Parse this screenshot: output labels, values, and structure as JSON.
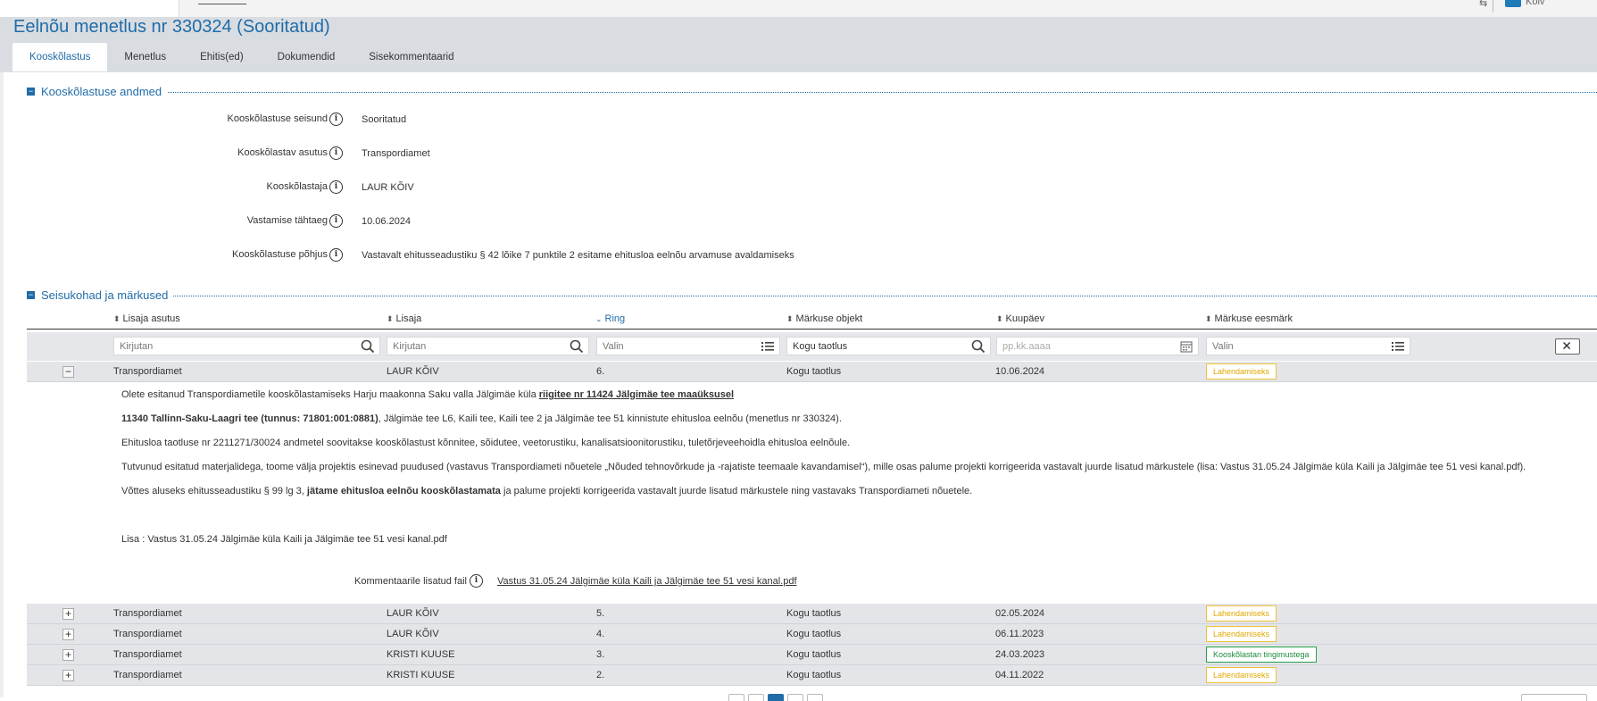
{
  "top_bar": {
    "user_name": "Kõiv"
  },
  "page": {
    "title": "Eelnõu menetlus nr 330324 (Sooritatud)"
  },
  "tabs": [
    {
      "label": "Kooskõlastus"
    },
    {
      "label": "Menetlus"
    },
    {
      "label": "Ehitis(ed)"
    },
    {
      "label": "Dokumendid"
    },
    {
      "label": "Sisekommentaarid"
    }
  ],
  "section1": {
    "title": "Kooskõlastuse andmed",
    "fields": [
      {
        "label": "Kooskõlastuse seisund",
        "value": "Sooritatud"
      },
      {
        "label": "Kooskõlastav asutus",
        "value": "Transpordiamet"
      },
      {
        "label": "Kooskõlastaja",
        "value": "LAUR KÕIV"
      },
      {
        "label": "Vastamise tähtaeg",
        "value": "10.06.2024"
      },
      {
        "label": "Kooskõlastuse põhjus",
        "value": "Vastavalt ehitusseadustiku § 42 lõike 7 punktile 2 esitame ehitusloa eelnõu arvamuse avaldamiseks"
      }
    ]
  },
  "section2": {
    "title": "Seisukohad ja märkused",
    "columns": [
      "Lisaja asutus",
      "Lisaja",
      "Ring",
      "Märkuse objekt",
      "Kuupäev",
      "Märkuse eesmärk"
    ],
    "filters": {
      "asutus": "Kirjutan",
      "lisaja": "Kirjutan",
      "ring": "Valin",
      "objekt": "Kogu taotlus",
      "kuupaev": "pp.kk.aaaa",
      "eesmark": "Valin"
    },
    "rows": [
      {
        "toggle": "−",
        "asutus": "Transpordiamet",
        "lisaja": "LAUR KÕIV",
        "ring": "6.",
        "objekt": "Kogu taotlus",
        "kuupaev": "10.06.2024",
        "eesmark": "Lahendamiseks",
        "badge": "yellow"
      },
      {
        "toggle": "+",
        "asutus": "Transpordiamet",
        "lisaja": "LAUR KÕIV",
        "ring": "5.",
        "objekt": "Kogu taotlus",
        "kuupaev": "02.05.2024",
        "eesmark": "Lahendamiseks",
        "badge": "yellow"
      },
      {
        "toggle": "+",
        "asutus": "Transpordiamet",
        "lisaja": "LAUR KÕIV",
        "ring": "4.",
        "objekt": "Kogu taotlus",
        "kuupaev": "06.11.2023",
        "eesmark": "Lahendamiseks",
        "badge": "yellow"
      },
      {
        "toggle": "+",
        "asutus": "Transpordiamet",
        "lisaja": "KRISTI KUUSE",
        "ring": "3.",
        "objekt": "Kogu taotlus",
        "kuupaev": "24.03.2023",
        "eesmark": "Kooskõlastan tingimustega",
        "badge": "green"
      },
      {
        "toggle": "+",
        "asutus": "Transpordiamet",
        "lisaja": "KRISTI KUUSE",
        "ring": "2.",
        "objekt": "Kogu taotlus",
        "kuupaev": "04.11.2022",
        "eesmark": "Lahendamiseks",
        "badge": "yellow"
      }
    ],
    "detail": {
      "p1_a": "Olete esitanud Transpordiametile kooskõlastamiseks Harju maakonna Saku valla Jälgimäe küla ",
      "p1_link": "riigitee nr 11424 Jälgimäe tee maaüksusel",
      "p2_bold": "11340 Tallinn-Saku-Laagri tee (tunnus: 71801:001:0881)",
      "p2_rest": ", Jälgimäe tee L6, Kaili tee, Kaili tee 2 ja Jälgimäe tee 51 kinnistute ehitusloa eelnõu (menetlus nr 330324).",
      "p3": "Ehitusloa taotluse nr 2211271/30024 andmetel soovitakse kooskõlastust kõnnitee, sõidutee, veetorustiku, kanalisatsioonitorustiku, tuletõrjeveehoidla ehitusloa eelnõule.",
      "p4": "Tutvunud esitatud materjalidega, toome välja projektis esinevad puudused (vastavus Transpordiameti nõuetele „Nõuded tehnovõrkude ja -rajatiste teemaale kavandamisel“), mille osas palume projekti korrigeerida vastavalt juurde lisatud märkustele (lisa: Vastus 31.05.24 Jälgimäe küla Kaili ja Jälgimäe tee 51 vesi kanal.pdf).",
      "p5_a": "Võttes aluseks ehitusseadustiku § 99 lg 3, ",
      "p5_bold": "jätame ehitusloa eelnõu kooskõlastamata",
      "p5_b": " ja palume projekti korrigeerida vastavalt juurde lisatud märkustele ning vastavaks Transpordiameti nõuetele.",
      "p6": "Lisa : Vastus 31.05.24 Jälgimäe küla Kaili ja Jälgimäe tee 51 vesi kanal.pdf",
      "attach_label": "Kommentaarile lisatud fail",
      "attach_link": "Vastus 31.05.24 Jälgimäe küla Kaili ja Jälgimäe tee 51 vesi kanal.pdf"
    }
  }
}
